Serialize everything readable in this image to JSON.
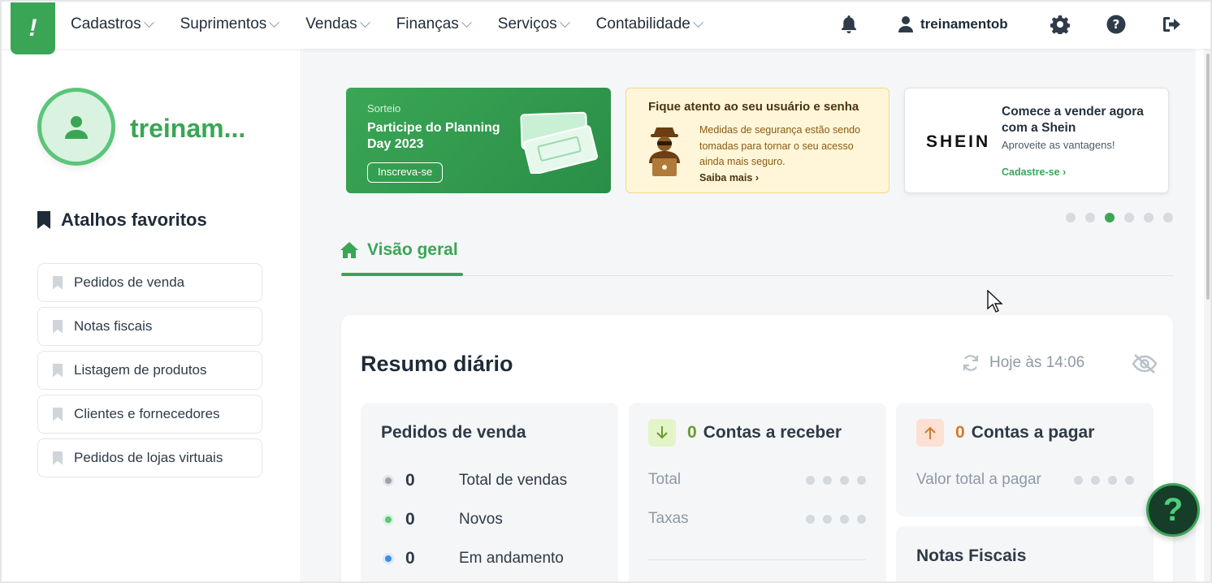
{
  "logo": {
    "glyph": "!"
  },
  "nav": {
    "items": [
      {
        "label": "Cadastros"
      },
      {
        "label": "Suprimentos"
      },
      {
        "label": "Vendas"
      },
      {
        "label": "Finanças"
      },
      {
        "label": "Serviços"
      },
      {
        "label": "Contabilidade"
      }
    ]
  },
  "header": {
    "user_name": "treinamentob"
  },
  "sidebar": {
    "profile_name": "treinam...",
    "favorites_title": "Atalhos favoritos",
    "favorites": [
      {
        "label": "Pedidos de venda"
      },
      {
        "label": "Notas fiscais"
      },
      {
        "label": "Listagem de produtos"
      },
      {
        "label": "Clientes e fornecedores"
      },
      {
        "label": "Pedidos de lojas virtuais"
      }
    ]
  },
  "banners": {
    "planning": {
      "tag": "Sorteio",
      "title": "Participe do Planning Day 2023",
      "button": "Inscreva-se"
    },
    "security": {
      "title": "Fique atento ao seu usuário e senha",
      "text": "Medidas de segurança estão sendo tomadas para tornar o seu acesso ainda mais seguro.",
      "link": "Saiba mais"
    },
    "shein": {
      "brand": "SHEIN",
      "title": "Comece a vender agora com a Shein",
      "subtitle": "Aproveite as vantagens!",
      "link": "Cadastre-se"
    },
    "active_index": 2,
    "count": 6
  },
  "tabs": {
    "active": "Visão geral"
  },
  "summary": {
    "title": "Resumo diário",
    "updated": "Hoje às 14:06",
    "sales": {
      "title": "Pedidos de venda",
      "rows": [
        {
          "count": "0",
          "label": "Total de vendas",
          "color": "#9aa3ad"
        },
        {
          "count": "0",
          "label": "Novos",
          "color": "#5bc57a"
        },
        {
          "count": "0",
          "label": "Em andamento",
          "color": "#3b8ee6"
        }
      ]
    },
    "receivable": {
      "count": "0",
      "title": "Contas a receber",
      "rows": [
        {
          "label": "Total"
        },
        {
          "label": "Taxas"
        }
      ],
      "accent": "#6a9a2f"
    },
    "payable": {
      "count": "0",
      "title": "Contas a pagar",
      "rows": [
        {
          "label": "Valor total a pagar"
        }
      ],
      "accent": "#d27a2c"
    },
    "invoices": {
      "title": "Notas Fiscais"
    }
  },
  "help": {
    "glyph": "?"
  }
}
